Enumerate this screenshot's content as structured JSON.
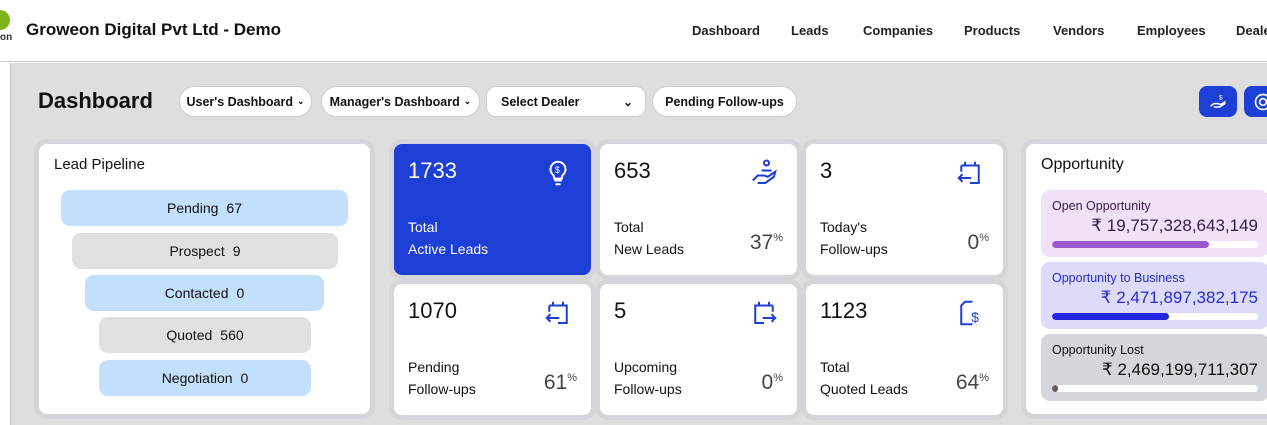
{
  "header": {
    "title": "Groweon Digital Pvt Ltd - Demo",
    "logo_text": "on",
    "nav": [
      "Dashboard",
      "Leads",
      "Companies",
      "Products",
      "Vendors",
      "Employees",
      "Dealers"
    ]
  },
  "toolbar": {
    "page_title": "Dashboard",
    "users_dashboard": "User's Dashboard",
    "managers_dashboard": "Manager's Dashboard",
    "select_dealer": "Select Dealer",
    "pending_followups": "Pending Follow-ups"
  },
  "pipeline": {
    "title": "Lead Pipeline",
    "stages": [
      {
        "label": "Pending",
        "count": "67"
      },
      {
        "label": "Prospect",
        "count": "9"
      },
      {
        "label": "Contacted",
        "count": "0"
      },
      {
        "label": "Quoted",
        "count": "560"
      },
      {
        "label": "Negotiation",
        "count": "0"
      }
    ]
  },
  "stats": [
    {
      "value": "1733",
      "line1": "Total",
      "line2": "Active Leads",
      "pct": "",
      "icon": "lightbulb-dollar-icon"
    },
    {
      "value": "653",
      "line1": "Total",
      "line2": "New Leads",
      "pct": "37",
      "icon": "hand-user-icon"
    },
    {
      "value": "3",
      "line1": "Today's",
      "line2": "Follow-ups",
      "pct": "0",
      "icon": "calendar-arrow-left-icon"
    },
    {
      "value": "1070",
      "line1": "Pending",
      "line2": "Follow-ups",
      "pct": "61",
      "icon": "calendar-arrow-left-icon"
    },
    {
      "value": "5",
      "line1": "Upcoming",
      "line2": "Follow-ups",
      "pct": "0",
      "icon": "calendar-arrow-right-icon"
    },
    {
      "value": "1123",
      "line1": "Total",
      "line2": "Quoted Leads",
      "pct": "64",
      "icon": "document-dollar-icon"
    }
  ],
  "percent_sign": "%",
  "opportunity": {
    "title": "Opportunity",
    "items": [
      {
        "label": "Open Opportunity",
        "amount": "₹ 19,757,328,643,149",
        "progress": 76,
        "bg": "#f0e1f7",
        "color": "#9b59d0",
        "text": "#3a1a4a"
      },
      {
        "label": "Opportunity to Business",
        "amount": "₹ 2,471,897,382,175",
        "progress": 57,
        "bg": "#dcdcfa",
        "color": "#2323e0",
        "text": "#2a2ad0"
      },
      {
        "label": "Opportunity Lost",
        "amount": "₹ 2,469,199,711,307",
        "progress": 1,
        "bg": "#d3d6da",
        "color": "#6a5a5a",
        "text": "#111"
      }
    ]
  }
}
